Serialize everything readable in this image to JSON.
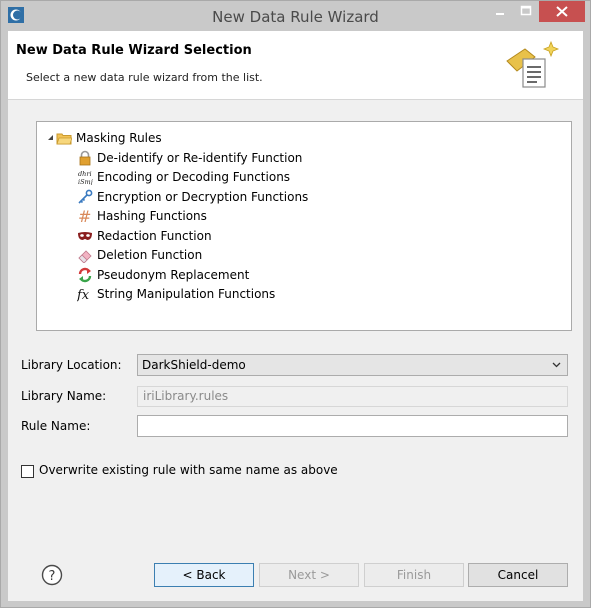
{
  "window": {
    "title": "New Data Rule Wizard"
  },
  "header": {
    "title": "New Data Rule Wizard Selection",
    "subtitle": "Select a new data rule wizard from the list."
  },
  "tree": {
    "root": {
      "label": "Masking Rules",
      "icon": "folder-icon",
      "expanded": true
    },
    "items": [
      {
        "label": "De-identify or Re-identify Function",
        "icon": "lock-icon"
      },
      {
        "label": "Encoding or Decoding Functions",
        "icon": "encoding-icon",
        "icon_text_top": "dhri",
        "icon_text_bottom": "iSmj"
      },
      {
        "label": "Encryption or Decryption Functions",
        "icon": "key-icon"
      },
      {
        "label": "Hashing Functions",
        "icon": "hash-icon",
        "icon_text": "#"
      },
      {
        "label": "Redaction Function",
        "icon": "mask-icon"
      },
      {
        "label": "Deletion Function",
        "icon": "eraser-icon"
      },
      {
        "label": "Pseudonym Replacement",
        "icon": "pseudonym-icon"
      },
      {
        "label": "String Manipulation Functions",
        "icon": "function-icon",
        "icon_text": "fx"
      }
    ]
  },
  "form": {
    "library_location_label": "Library Location:",
    "library_location_value": "DarkShield-demo",
    "library_name_label": "Library Name:",
    "library_name_value": "iriLibrary.rules",
    "rule_name_label": "Rule Name:",
    "rule_name_value": "",
    "overwrite_label": "Overwrite existing rule with same name as above",
    "overwrite_checked": false
  },
  "buttons": {
    "help_icon": "help-icon",
    "help_glyph": "?",
    "back": "< Back",
    "next": "Next >",
    "finish": "Finish",
    "cancel": "Cancel"
  },
  "colors": {
    "close_button": "#c75050",
    "title_bar": "#c9c9c9",
    "focused_button_border": "#3c7fb1"
  }
}
